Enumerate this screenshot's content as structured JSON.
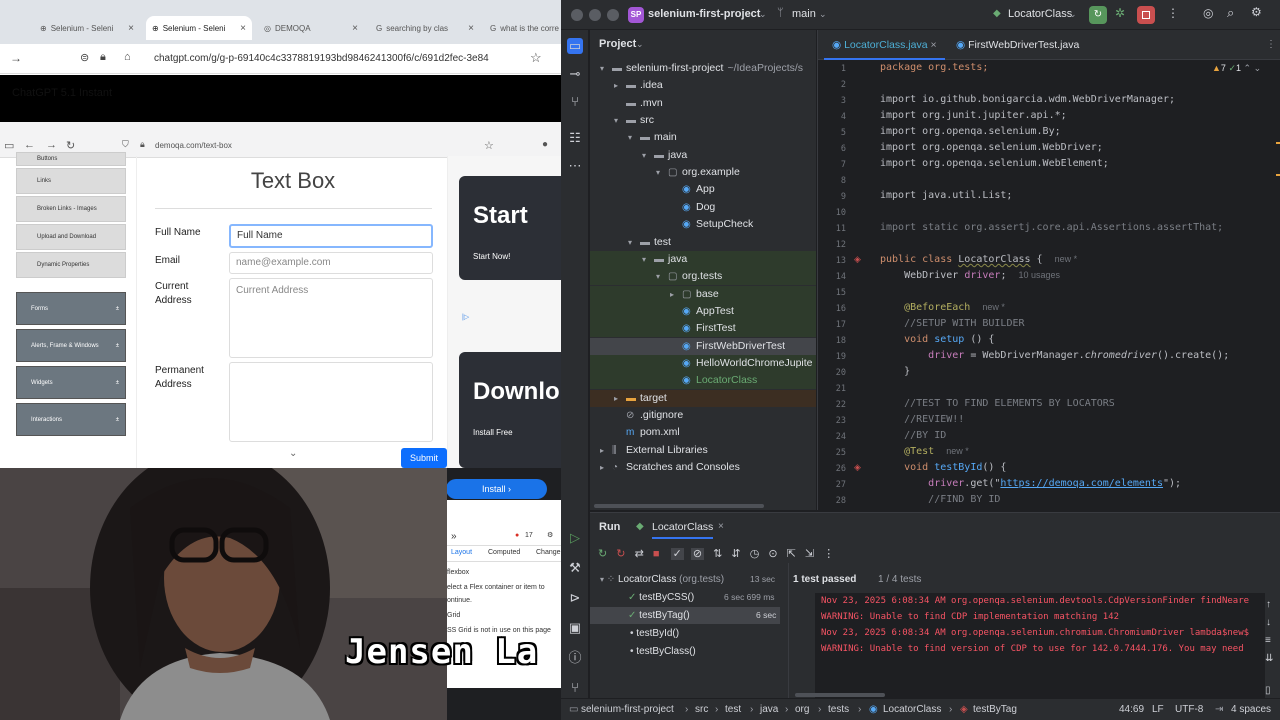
{
  "browser": {
    "tabs": [
      {
        "label": "Selenium - Seleni",
        "active": false
      },
      {
        "label": "Selenium - Seleni",
        "active": true
      },
      {
        "label": "DEMOQA",
        "active": false
      },
      {
        "label": "searching by clas",
        "active": false
      },
      {
        "label": "what is the corre",
        "active": false
      }
    ],
    "url": "chatgpt.com/g/g-p-69140c4c3378819193bd9846241300f6/c/691d2fec-3e84",
    "chat_header": "ChatGPT 5.1 Instant"
  },
  "demoqa": {
    "url": "demoqa.com/text-box",
    "nav_items": [
      "Buttons",
      "Links",
      "Broken Links - Images",
      "Upload and Download",
      "Dynamic Properties"
    ],
    "nav_groups": [
      "Forms",
      "Alerts, Frame & Windows",
      "Widgets",
      "Interactions"
    ],
    "title": "Text Box",
    "fields": {
      "full_name_label": "Full Name",
      "full_name_placeholder": "Full Name",
      "email_label": "Email",
      "email_placeholder": "name@example.com",
      "current_address_label": "Current Address",
      "current_address_placeholder": "Current Address",
      "permanent_address_label": "Permanent Address"
    },
    "submit_label": "Submit",
    "ads": [
      {
        "headline": "Start",
        "sub": "Start Now!"
      },
      {
        "headline": "Downlo",
        "sub": "Install Free"
      }
    ],
    "install_label": "Install"
  },
  "devtools": {
    "tabs": [
      "Layout",
      "Computed",
      "Change"
    ],
    "issues_count": "17",
    "lines": [
      "flexbox",
      "elect a Flex container or item to",
      "ontinue.",
      "Grid",
      "SS Grid is not in use on this page"
    ]
  },
  "webcam": {
    "overlay_text": "Jensen La"
  },
  "ide": {
    "project_badge": "SP",
    "project_name": "selenium-first-project",
    "branch": "main",
    "run_config": "LocatorClass",
    "panel_title": "Project",
    "tree": [
      {
        "label": "selenium-first-project",
        "extra": "~/IdeaProjects/s",
        "depth": 0,
        "arrow": "▾",
        "icon": "folder-icon",
        "style": ""
      },
      {
        "label": ".idea",
        "depth": 1,
        "arrow": "▸",
        "icon": "folder-icon",
        "style": ""
      },
      {
        "label": ".mvn",
        "depth": 1,
        "arrow": "",
        "icon": "folder-icon",
        "style": ""
      },
      {
        "label": "src",
        "depth": 1,
        "arrow": "▾",
        "icon": "folder-icon",
        "style": ""
      },
      {
        "label": "main",
        "depth": 2,
        "arrow": "▾",
        "icon": "folder-icon",
        "style": ""
      },
      {
        "label": "java",
        "depth": 3,
        "arrow": "▾",
        "icon": "folder-icon",
        "style": ""
      },
      {
        "label": "org.example",
        "depth": 4,
        "arrow": "▾",
        "icon": "package-icon",
        "style": ""
      },
      {
        "label": "App",
        "depth": 5,
        "arrow": "",
        "icon": "class-icon",
        "style": ""
      },
      {
        "label": "Dog",
        "depth": 5,
        "arrow": "",
        "icon": "class-icon",
        "style": ""
      },
      {
        "label": "SetupCheck",
        "depth": 5,
        "arrow": "",
        "icon": "class-icon",
        "style": ""
      },
      {
        "label": "test",
        "depth": 2,
        "arrow": "▾",
        "icon": "folder-icon",
        "style": ""
      },
      {
        "label": "java",
        "depth": 3,
        "arrow": "▾",
        "icon": "folder-icon",
        "style": "hlgreen"
      },
      {
        "label": "org.tests",
        "depth": 4,
        "arrow": "▾",
        "icon": "package-icon",
        "style": "hlgreen"
      },
      {
        "label": "base",
        "depth": 5,
        "arrow": "▸",
        "icon": "package-icon",
        "style": "hlgreen"
      },
      {
        "label": "AppTest",
        "depth": 5,
        "arrow": "",
        "icon": "class-icon",
        "style": "hlgreen"
      },
      {
        "label": "FirstTest",
        "depth": 5,
        "arrow": "",
        "icon": "class-icon",
        "style": "hlgreen"
      },
      {
        "label": "FirstWebDriverTest",
        "depth": 5,
        "arrow": "",
        "icon": "class-icon",
        "style": "sel"
      },
      {
        "label": "HelloWorldChromeJupite",
        "depth": 5,
        "arrow": "",
        "icon": "class-icon",
        "style": "hlgreen"
      },
      {
        "label": "LocatorClass",
        "depth": 5,
        "arrow": "",
        "icon": "class-icon",
        "style": "hlgreen green"
      },
      {
        "label": "target",
        "depth": 1,
        "arrow": "▸",
        "icon": "folder-icon",
        "style": "hltarget"
      },
      {
        "label": ".gitignore",
        "depth": 1,
        "arrow": "",
        "icon": "file-icon",
        "style": ""
      },
      {
        "label": "pom.xml",
        "depth": 1,
        "arrow": "",
        "icon": "maven-icon",
        "style": ""
      },
      {
        "label": "External Libraries",
        "depth": 0,
        "arrow": "▸",
        "icon": "library-icon",
        "style": ""
      },
      {
        "label": "Scratches and Consoles",
        "depth": 0,
        "arrow": "▸",
        "icon": "scratch-icon",
        "style": ""
      }
    ],
    "editor_tabs": [
      "LocatorClass.java",
      "FirstWebDriverTest.java"
    ],
    "inspections": {
      "warnings": "7",
      "ok": "1"
    },
    "line_numbers": [
      "1",
      "2",
      "3",
      "4",
      "5",
      "6",
      "7",
      "8",
      "9",
      "10",
      "11",
      "12",
      "13",
      "14",
      "15",
      "16",
      "17",
      "18",
      "19",
      "20",
      "21",
      "22",
      "23",
      "24",
      "25",
      "26",
      "27",
      "28"
    ],
    "code": {
      "l1": "package org.tests;",
      "l3": "import io.github.bonigarcia.wdm.WebDriverManager;",
      "l4": "import org.junit.jupiter.api.*;",
      "l5": "import org.openqa.selenium.By;",
      "l6": "import org.openqa.selenium.WebDriver;",
      "l7": "import org.openqa.selenium.WebElement;",
      "l9": "import java.util.List;",
      "l11": "import static org.assertj.core.api.Assertions.assertThat;",
      "l13a": "public class ",
      "l13b": "LocatorClass",
      "l13c": " {",
      "l13h": "new *",
      "l14a": "WebDriver ",
      "l14b": "driver",
      "l14c": ";",
      "l14h": "10 usages",
      "l16": "@BeforeEach",
      "l16h": "new *",
      "l17": "//SETUP WITH BUILDER",
      "l18a": "void ",
      "l18b": "setup",
      "l18c": " () {",
      "l19a": "driver",
      "l19b": " = WebDriverManager.",
      "l19c": "chromedriver",
      "l19d": "().create();",
      "l20": "}",
      "l22": "//TEST TO FIND ELEMENTS BY LOCATORS",
      "l23": "//REVIEW!!",
      "l24": "//BY ID",
      "l25": "@Test",
      "l25h": "new *",
      "l26a": "void ",
      "l26b": "testById",
      "l26c": "() {",
      "l27a": "driver",
      "l27b": ".get(\"",
      "l27c": "https://demoqa.com/elements",
      "l27d": "\");",
      "l28": "//FIND BY ID"
    },
    "run": {
      "tab_label": "Run",
      "config_tab": "LocatorClass",
      "root": {
        "label": "LocatorClass",
        "pkg": "(org.tests)",
        "time": "13 sec"
      },
      "tests": [
        {
          "label": "testByCSS()",
          "time": "6 sec 699 ms",
          "status": "passed"
        },
        {
          "label": "testByTag()",
          "time": "6 sec",
          "status": "passed"
        },
        {
          "label": "testById()",
          "time": "",
          "status": "pending"
        },
        {
          "label": "testByClass()",
          "time": "",
          "status": "pending"
        }
      ],
      "summary": "1 test passed",
      "summary_count": "1 / 4 tests",
      "console": [
        "Nov 23, 2025 6:08:34 AM org.openqa.selenium.devtools.CdpVersionFinder findNeare",
        "WARNING: Unable to find CDP implementation matching 142",
        "Nov 23, 2025 6:08:34 AM org.openqa.selenium.chromium.ChromiumDriver lambda$new$",
        "WARNING: Unable to find version of CDP to use for 142.0.7444.176. You may need"
      ]
    },
    "status": {
      "breadcrumb": [
        "selenium-first-project",
        "src",
        "test",
        "java",
        "org",
        "tests",
        "LocatorClass",
        "testByTag"
      ],
      "position": "44:69",
      "line_sep": "LF",
      "encoding": "UTF-8",
      "indent": "4 spaces"
    }
  }
}
